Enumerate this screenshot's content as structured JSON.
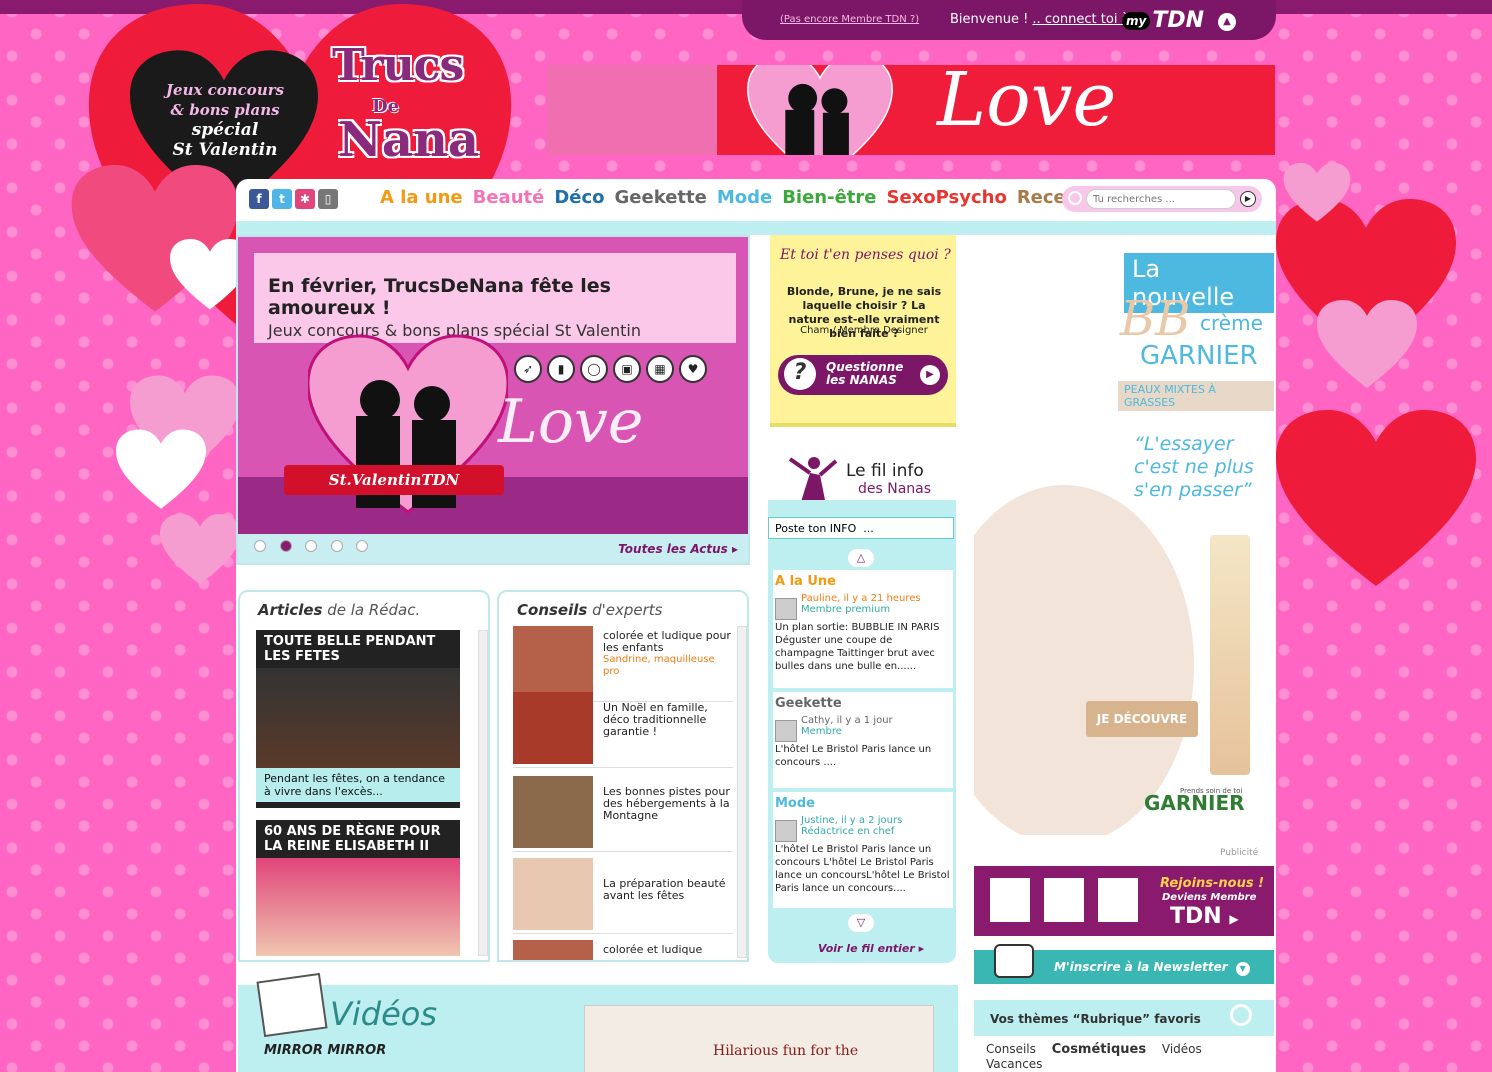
{
  "top": {
    "not_member": "(Pas encore Membre TDN ?)",
    "welcome": "Bienvenue ! ",
    "connect": ".. connect toi à",
    "mytdn_my": "my",
    "mytdn_tdn": "TDN"
  },
  "logo": {
    "heart_text": [
      "Jeux concours",
      "& bons plans",
      "spécial",
      "St Valentin"
    ],
    "l1": "Trucs",
    "l2": "De",
    "l3": "Nana"
  },
  "banner": {
    "love": "Love"
  },
  "social": [
    "f",
    "t",
    "✱",
    "▯"
  ],
  "nav": [
    {
      "label": "A la une",
      "color": "#f39a12"
    },
    {
      "label": "Beauté",
      "color": "#f472b6"
    },
    {
      "label": "Déco",
      "color": "#1f6fa8"
    },
    {
      "label": "Geekette",
      "color": "#666666"
    },
    {
      "label": "Mode",
      "color": "#4db9e0"
    },
    {
      "label": "Bien-être",
      "color": "#3aa83a"
    },
    {
      "label": "SexoPsycho",
      "color": "#e8352f"
    },
    {
      "label": "Recettes",
      "color": "#a87a4a"
    }
  ],
  "search": {
    "placeholder": "Tu recherches ..."
  },
  "slider": {
    "headline": "En février, TrucsDeNana fête les amoureux !",
    "subline": "Jeux concours & bons plans spécial St Valentin",
    "ribbon": "St.ValentinTDN",
    "love": "Love",
    "dots": 5,
    "active_dot": 1,
    "all_news": "Toutes les Actus"
  },
  "articles": {
    "title_bold": "Articles",
    "title_rest": " de la Rédac.",
    "items": [
      {
        "title": "TOUTE BELLE PENDANT LES FETES",
        "caption": "Pendant les fêtes, on a tendance à vivre dans l'excès..."
      },
      {
        "title": "60 ans de règne pour la reine ELISABETH II",
        "caption": ""
      }
    ]
  },
  "conseils": {
    "title_bold": "Conseils",
    "title_rest": " d'experts",
    "items": [
      {
        "text": "colorée et ludique pour les enfants",
        "author": "Sandrine,  maquilleuse pro"
      },
      {
        "text": "Un Noël en famille, déco traditionnelle garantie !",
        "author": ""
      },
      {
        "text": "Les bonnes pistes pour des hébergements à la Montagne",
        "author": ""
      },
      {
        "text": "La préparation beauté avant les fêtes",
        "author": ""
      },
      {
        "text": "colorée et ludique",
        "author": ""
      }
    ]
  },
  "postit": {
    "question": "Et toi t'en penses quoi ?",
    "text": "Blonde, Brune, je ne sais laquelle choisir ? La nature est-elle vraiment bien faite ?",
    "author": "Cham / Membre Designer",
    "button_l1": "Questionne",
    "button_l2": "les NANAS"
  },
  "filinfo": {
    "title1": "Le fil info",
    "title2": "des Nanas",
    "input_value": "Poste ton INFO  ...",
    "entries": [
      {
        "cat": "A la Une",
        "cat_color": "#f39a12",
        "who": "Pauline,  il y a 21 heures",
        "role": "Membre premium",
        "body": "Un plan sortie: BUBBLIE IN PARIS Déguster une coupe de champagne Taittinger brut  avec bulles dans une bulle en......"
      },
      {
        "cat": "Geekette",
        "cat_color": "#666666",
        "who": "Cathy,  il y a 1 jour",
        "role": "Membre",
        "body": "L'hôtel Le Bristol Paris lance un concours ...."
      },
      {
        "cat": "Mode",
        "cat_color": "#4db9e0",
        "who": "Justine,  il y a 2 jours",
        "role": "Rédactrice en chef",
        "body": "L'hôtel Le Bristol Paris lance un concours L'hôtel Le Bristol Paris lance un concoursL'hôtel Le Bristol Paris lance un concours...."
      }
    ],
    "see_all": "Voir le fil entier"
  },
  "ad": {
    "nouvelle": "La nouvelle",
    "bb": "BB",
    "creme": "crème",
    "brand": "GARNIER",
    "skin": "PEAUX MIXTES À GRASSES",
    "quote": "“L'essayer c'est ne plus s'en passer”",
    "button": "JE DÉCOUVRE",
    "logo": "GARNIER",
    "tagline": "Prends soin de toi",
    "pub": "Publicité"
  },
  "rejoins": {
    "t1": "Rejoins-nous !",
    "t2": "Deviens Membre",
    "t3": "TDN"
  },
  "newsletter": {
    "label": "M'inscrire à la Newsletter"
  },
  "themes": {
    "title": "Vos thèmes “Rubrique” favoris",
    "items": [
      "Conseils",
      "Cosmétiques",
      "Vidéos",
      "Vacances"
    ]
  },
  "videos": {
    "title": "Vidéos",
    "movie": "MIRROR MIRROR",
    "poster_text": "Hilarious fun for the"
  }
}
